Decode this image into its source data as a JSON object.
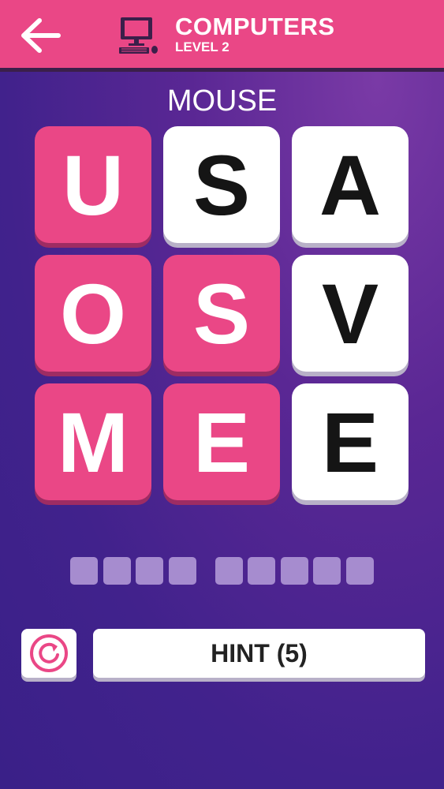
{
  "header": {
    "back_icon": "arrow-left-icon",
    "category_icon": "computer-icon",
    "title": "COMPUTERS",
    "level": "LEVEL 2"
  },
  "target_word": "MOUSE",
  "grid": {
    "rows": 3,
    "cols": 3,
    "tiles": [
      {
        "letter": "U",
        "state": "selected"
      },
      {
        "letter": "S",
        "state": "free"
      },
      {
        "letter": "A",
        "state": "free"
      },
      {
        "letter": "O",
        "state": "selected"
      },
      {
        "letter": "S",
        "state": "selected"
      },
      {
        "letter": "V",
        "state": "free"
      },
      {
        "letter": "M",
        "state": "selected"
      },
      {
        "letter": "E",
        "state": "selected"
      },
      {
        "letter": "E",
        "state": "free"
      }
    ]
  },
  "answer_slots": {
    "word_lengths": [
      4,
      5
    ],
    "filled": 0
  },
  "controls": {
    "restart_icon": "restart-icon",
    "hint_label": "HINT (5)"
  },
  "colors": {
    "accent": "#ea4786",
    "tile_white": "#ffffff",
    "slot": "#a68ccf"
  }
}
